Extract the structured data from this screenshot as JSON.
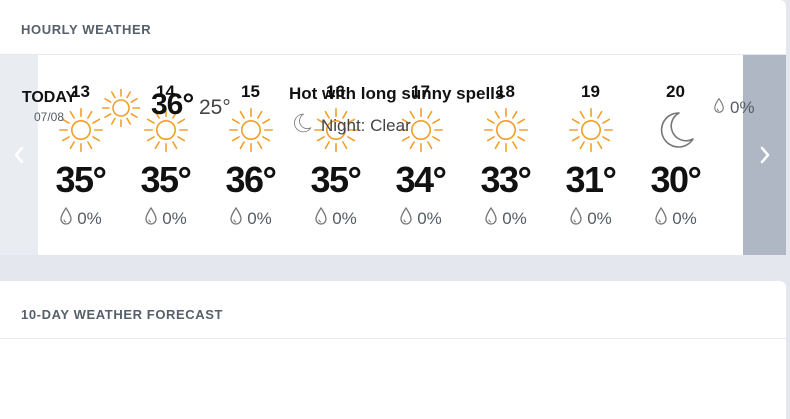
{
  "hourly": {
    "title": "HOURLY WEATHER",
    "prev_arrow": "‹",
    "next_arrow": "›",
    "colors": {
      "sun": "#f0a02a",
      "moon": "#777777",
      "drop": "#777777",
      "next_panel": "#aeb7c3"
    },
    "hours": [
      {
        "hour": "13",
        "icon": "sun-icon",
        "temp": "35°",
        "rain": "0%"
      },
      {
        "hour": "14",
        "icon": "sun-icon",
        "temp": "35°",
        "rain": "0%"
      },
      {
        "hour": "15",
        "icon": "sun-icon",
        "temp": "36°",
        "rain": "0%"
      },
      {
        "hour": "16",
        "icon": "sun-icon",
        "temp": "35°",
        "rain": "0%"
      },
      {
        "hour": "17",
        "icon": "sun-icon",
        "temp": "34°",
        "rain": "0%"
      },
      {
        "hour": "18",
        "icon": "sun-icon",
        "temp": "33°",
        "rain": "0%"
      },
      {
        "hour": "19",
        "icon": "sun-icon",
        "temp": "31°",
        "rain": "0%"
      },
      {
        "hour": "20",
        "icon": "moon-icon",
        "temp": "30°",
        "rain": "0%"
      }
    ]
  },
  "forecast": {
    "title": "10-DAY WEATHER FORECAST",
    "days": [
      {
        "day": "TODAY",
        "date": "07/08",
        "icon": "sun-icon",
        "high": "36°",
        "low": "25°",
        "summary": "Hot with long sunny spells",
        "night": "Night: Clear",
        "rain": "0%"
      }
    ]
  }
}
